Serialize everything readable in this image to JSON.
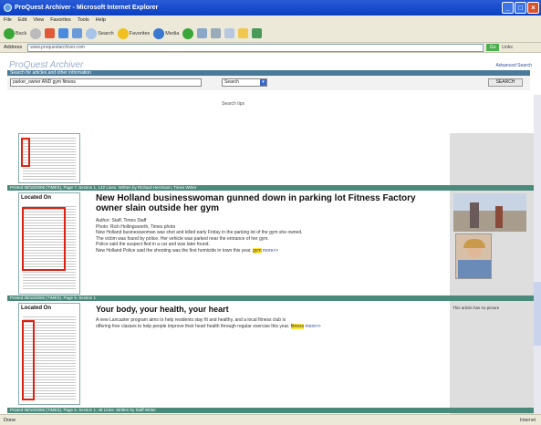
{
  "window": {
    "title": "ProQuest Archiver - Microsoft Internet Explorer",
    "buttons": [
      "_",
      "□",
      "×"
    ]
  },
  "menu": [
    "File",
    "Edit",
    "View",
    "Favorites",
    "Tools",
    "Help"
  ],
  "toolbar": {
    "back": "Back",
    "search": "Search",
    "favorites": "Favorites",
    "media": "Media"
  },
  "address": {
    "label": "Address",
    "value": "www.proquestarchiver.com",
    "go": "Go",
    "links": "Links"
  },
  "site": {
    "logo": "ProQuest Archiver",
    "advanced": "Advanced Search",
    "search_header": "Search for articles and other information",
    "search_value": "parker_owner AND gym fitness",
    "select_value": "Search",
    "tips": "Search tips",
    "button": "SEARCH"
  },
  "results": [
    {
      "meta": "Printed 08/18/2006 (TIMES), Page 7, Section 1, 142 Lines. Written by Richard Herrmann, Times Writer",
      "thumb_label": "Located On",
      "title": "New Holland businesswoman gunned down in parking lot Fitness Factory owner slain outside her gym",
      "body_lines": [
        "Author: Staff, Times Staff",
        "Photo: Rich Hollingsworth, Times photo",
        "New Holland businesswoman was shot and killed early Friday in the parking lot of the gym she owned.",
        "The victim was found by police. Her vehicle was parked near the entrance of her gym.",
        "Police said the suspect fled in a car and was later found.",
        "New Holland Police said the shooting was the first homicide in town this year."
      ],
      "highlight": "gym",
      "more": "more>>"
    },
    {
      "meta": "Printed 08/18/2006 (TIMES), Page 9, Section 1",
      "thumb_label": "Located On",
      "title": "Your body, your health, your heart",
      "body_lines": [
        "A new Lancaster program aims to help residents stay fit and healthy, and a local fitness club is",
        "offering free classes to help people improve their heart health through regular exercise this year."
      ],
      "highlight": "fitness",
      "more": "more>>",
      "side_note": "This article has no picture"
    },
    {
      "meta": "Printed 08/19/2006 (TIMES), Page 6, Section 1, 48 Lines. Written by Staff Writer"
    }
  ],
  "status": {
    "left": "Done",
    "right": "Internet"
  },
  "colors": {
    "titlebar": "#0a3fc0",
    "separator": "#4a8a7a",
    "search_header": "#4a7a9a",
    "highlight": "#ffe63a"
  }
}
